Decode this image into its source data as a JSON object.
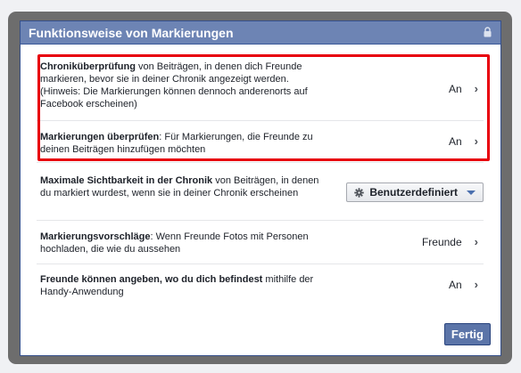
{
  "dialog": {
    "title": "Funktionsweise von Markierungen",
    "done_label": "Fertig"
  },
  "rows": [
    {
      "bold": "Chroniküberprüfung",
      "rest": " von Beiträgen, in denen dich Freunde markieren, bevor sie in deiner Chronik angezeigt werden. (Hinweis: Die Markierungen können dennoch anderenorts auf Facebook erscheinen)",
      "value": "An"
    },
    {
      "bold": "Markierungen überprüfen",
      "rest": ": Für Markierungen, die Freunde zu deinen Beiträgen hinzufügen möchten",
      "value": "An"
    },
    {
      "bold": "Maximale Sichtbarkeit in der Chronik",
      "rest": " von Beiträgen, in denen du markiert wurdest, wenn sie in deiner Chronik erscheinen",
      "value": "Benutzerdefiniert"
    },
    {
      "bold": "Markierungsvorschläge",
      "rest": ": Wenn Freunde Fotos mit Personen hochladen, die wie du aussehen",
      "value": "Freunde"
    },
    {
      "bold": "Freunde können angeben, wo du dich befindest",
      "rest": " mithilfe der Handy-Anwendung",
      "value": "An"
    }
  ],
  "icons": {
    "lock": "lock-icon",
    "gear": "gear-icon",
    "chevron": "chevron-right-icon",
    "dropdown": "caret-down-icon"
  },
  "colors": {
    "titlebar": "#6d84b4",
    "highlight": "#e8000c",
    "button": "#5b74a8"
  }
}
